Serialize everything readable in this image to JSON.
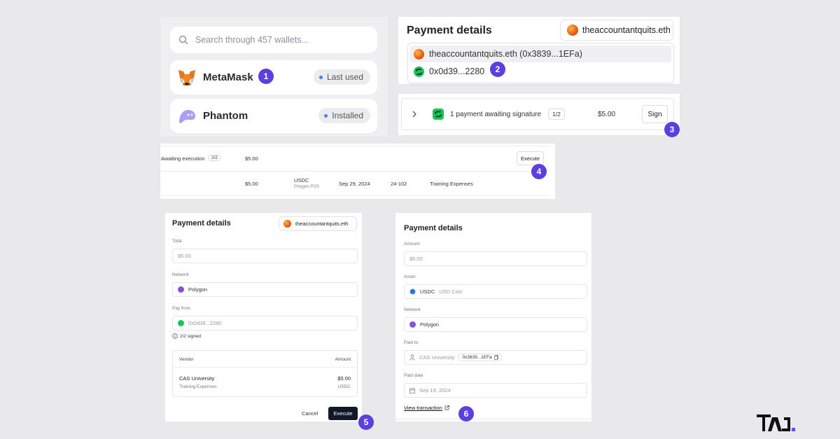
{
  "colors": {
    "step_badge": "#5b3fe0",
    "polygon": "#8b4fe0",
    "safe_green": "#16c55a",
    "usdc_blue": "#2775ca",
    "dark_button": "#111827",
    "background": "#e9e9ec"
  },
  "icons": [
    "search-icon",
    "metamask-fox-icon",
    "phantom-ghost-icon",
    "avatar-icon",
    "safe-icon",
    "chevron-right-icon",
    "polygon-icon",
    "usdc-icon",
    "info-icon",
    "user-icon",
    "copy-icon",
    "calendar-icon",
    "external-link-icon",
    "logo-mark"
  ],
  "steps": [
    "1",
    "2",
    "3",
    "4",
    "5",
    "6"
  ],
  "wallet_picker": {
    "search_placeholder": "Search through 457 wallets...",
    "wallets": [
      {
        "name": "MetaMask",
        "badge": "Last used"
      },
      {
        "name": "Phantom",
        "badge": "Installed"
      }
    ]
  },
  "payment_select": {
    "title": "Payment details",
    "ens": "theaccountantquits.eth",
    "options": [
      {
        "label": "theaccountantquits.eth (0x3839...1EFa)"
      },
      {
        "label": "0x0d39...2280"
      }
    ]
  },
  "signature_row": {
    "label": "1 payment awaiting signature",
    "count": "1/2",
    "amount": "$5.00",
    "button": "Sign"
  },
  "execution_table": {
    "status_label": "Awaiting execution",
    "count": "2/2",
    "total": "$5.00",
    "button": "Execute",
    "row": {
      "amount": "$5.00",
      "asset": "USDC",
      "network": "Polygon POS",
      "date": "Sep 29, 2024",
      "invoice": "24-102",
      "category": "Training Expenses"
    }
  },
  "execute_form": {
    "title": "Payment details",
    "ens": "theaccountantquits.eth",
    "total_label": "Total",
    "total_value": "$5.00",
    "network_label": "Network",
    "network_value": "Polygon",
    "payfrom_label": "Pay from",
    "payfrom_value": "0x0d39...2280",
    "signed_text": "2/2 signed",
    "vendor_header": "Vendor",
    "amount_header": "Amount",
    "vendor_name": "CAS University",
    "vendor_category": "Training Expenses",
    "vendor_amount": "$5.00",
    "vendor_asset": "USDC",
    "cancel_button": "Cancel",
    "execute_button": "Execute"
  },
  "receipt": {
    "title": "Payment details",
    "amount_label": "Amount",
    "amount_value": "$5.00",
    "asset_label": "Asset",
    "asset_symbol": "USDC",
    "asset_name": "USD Coin",
    "network_label": "Network",
    "network_value": "Polygon",
    "paidto_label": "Paid to",
    "paidto_name": "CAS University",
    "paidto_address": "0x3839...1EFa",
    "paiddate_label": "Paid date",
    "paiddate_value": "Sep 19, 2024",
    "view_link": "View transaction"
  }
}
